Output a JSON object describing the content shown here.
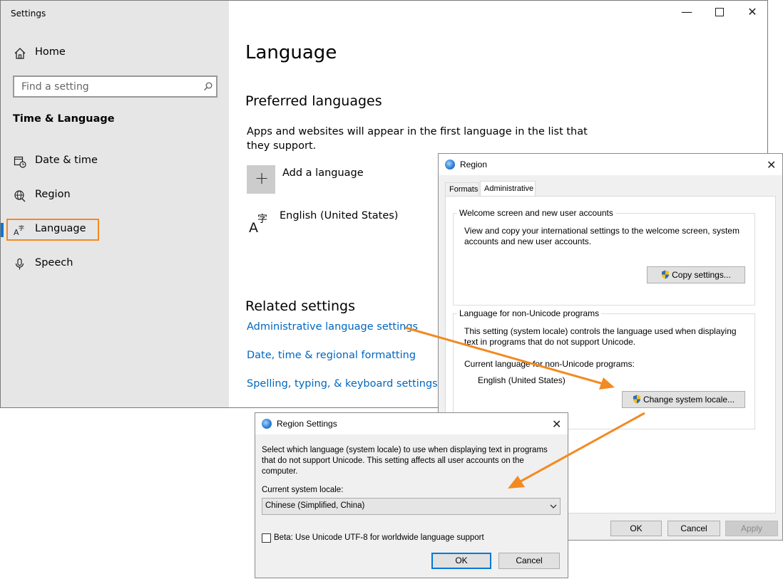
{
  "settings": {
    "window_title": "Settings",
    "nav": {
      "home": "Home",
      "search_placeholder": "Find a setting",
      "section": "Time & Language",
      "items": [
        "Date & time",
        "Region",
        "Language",
        "Speech"
      ]
    },
    "page_title": "Language",
    "preferred": {
      "heading": "Preferred languages",
      "desc_line1": "Apps and websites will appear in the first language in the list that",
      "desc_line2": "they support.",
      "add": "Add a language",
      "english": "English (United States)"
    },
    "related": {
      "heading": "Related settings",
      "links": [
        "Administrative language settings",
        "Date, time & regional formatting",
        "Spelling, typing, & keyboard settings"
      ]
    }
  },
  "region": {
    "title": "Region",
    "tabs": [
      "Formats",
      "Administrative"
    ],
    "welcome": {
      "label": "Welcome screen and new user accounts",
      "line1": "View and copy your international settings to the welcome screen, system",
      "line2": "accounts and new user accounts.",
      "button": "Copy settings..."
    },
    "nonunicode": {
      "label": "Language for non-Unicode programs",
      "line1": "This setting (system locale) controls the language used when displaying",
      "line2": "text in programs that do not support Unicode.",
      "current_label": "Current language for non-Unicode programs:",
      "current_value": "English (United States)",
      "button": "Change system locale..."
    },
    "buttons": {
      "ok": "OK",
      "cancel": "Cancel",
      "apply": "Apply"
    }
  },
  "region_settings": {
    "title": "Region Settings",
    "desc_line1": "Select which language (system locale) to use when displaying text in programs",
    "desc_line2": "that do not support Unicode. This setting affects all user accounts on the",
    "desc_line3": "computer.",
    "locale_label": "Current system locale:",
    "locale_value": "Chinese (Simplified, China)",
    "beta_label": "Beta: Use Unicode UTF-8 for worldwide language support",
    "buttons": {
      "ok": "OK",
      "cancel": "Cancel"
    }
  },
  "colors": {
    "accent": "#0078d7",
    "highlight": "#f28a22",
    "link": "#0067c0"
  }
}
